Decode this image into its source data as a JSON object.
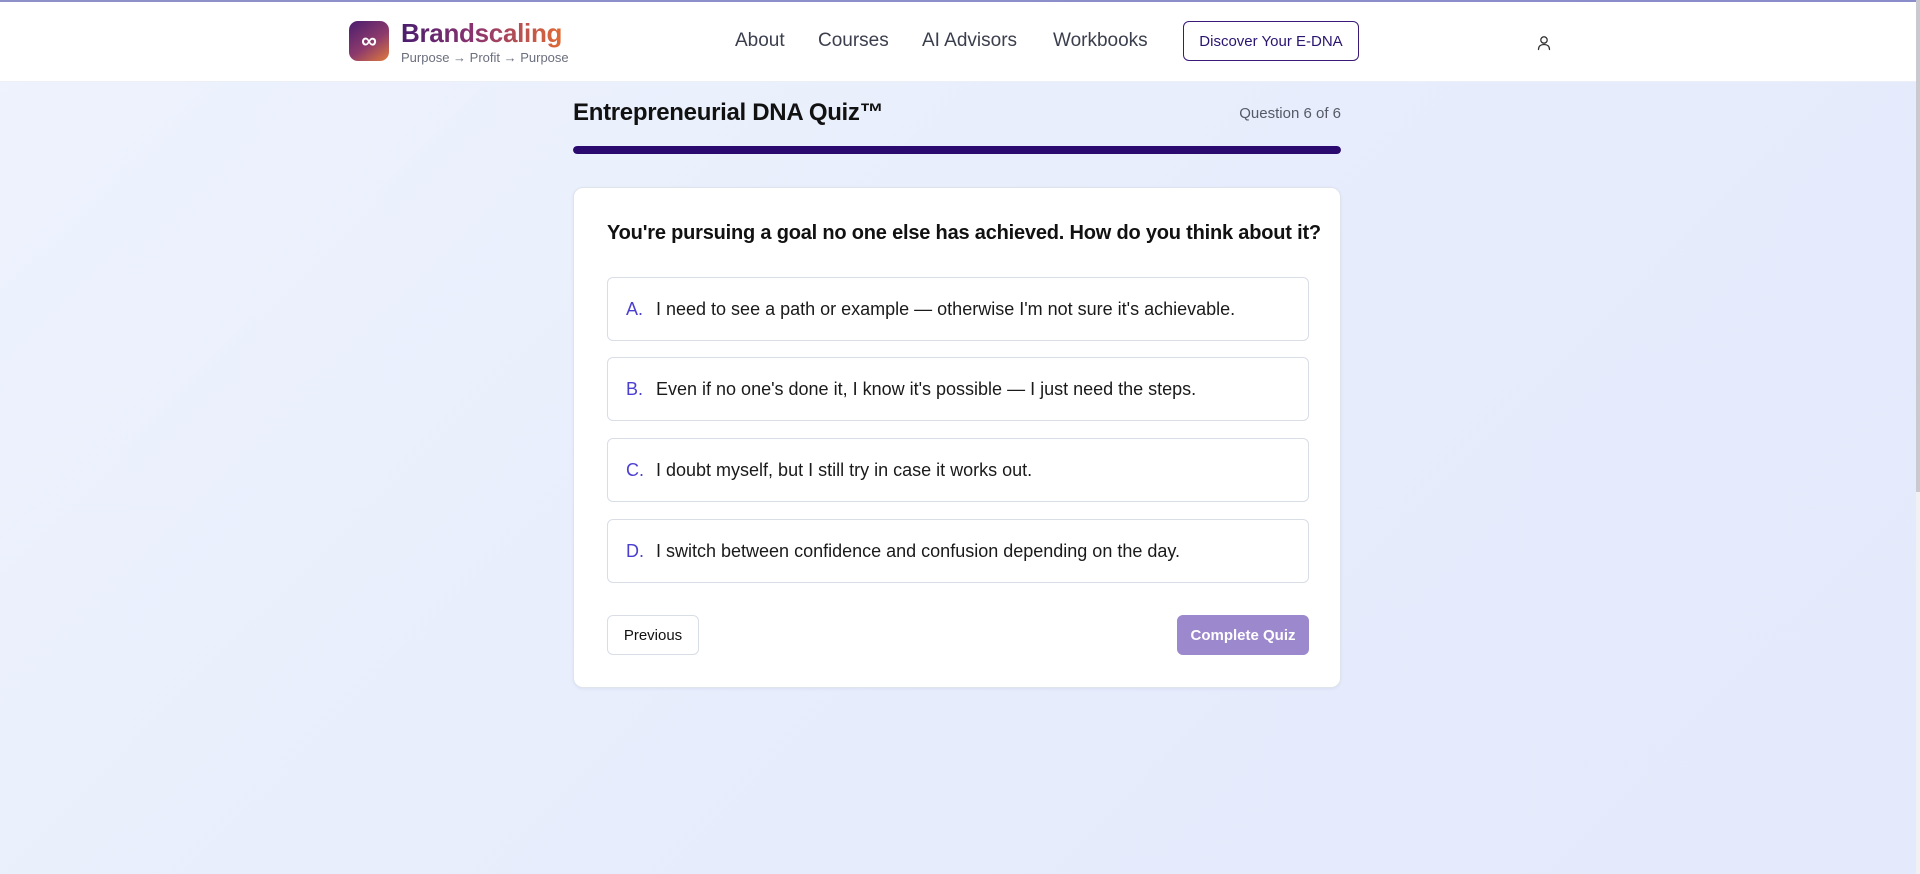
{
  "header": {
    "brand_name": "Brandscaling",
    "brand_tagline": "Purpose → Profit → Purpose",
    "logo_glyph": "∞",
    "nav": {
      "about": "About",
      "courses": "Courses",
      "ai_advisors": "AI Advisors",
      "workbooks": "Workbooks"
    },
    "cta_label": "Discover Your E-DNA",
    "user_icon": "user-icon"
  },
  "quiz": {
    "title": "Entrepreneurial DNA Quiz™",
    "progress_text": "Question 6 of 6",
    "progress_fraction": 1.0,
    "question": "You're pursuing a goal no one else has achieved. How do you think about it?",
    "options": [
      {
        "letter": "A.",
        "text": "I need to see a path or example — otherwise I'm not sure it's achievable."
      },
      {
        "letter": "B.",
        "text": "Even if no one's done it, I know it's possible — I just need the steps."
      },
      {
        "letter": "C.",
        "text": "I doubt myself, but I still try in case it works out."
      },
      {
        "letter": "D.",
        "text": "I switch between confidence and confusion depending on the day."
      }
    ],
    "previous_label": "Previous",
    "complete_label": "Complete Quiz"
  },
  "colors": {
    "accent": "#2a0a6e",
    "option_letter": "#4b3fd1",
    "complete_button": "#9b88cd"
  }
}
